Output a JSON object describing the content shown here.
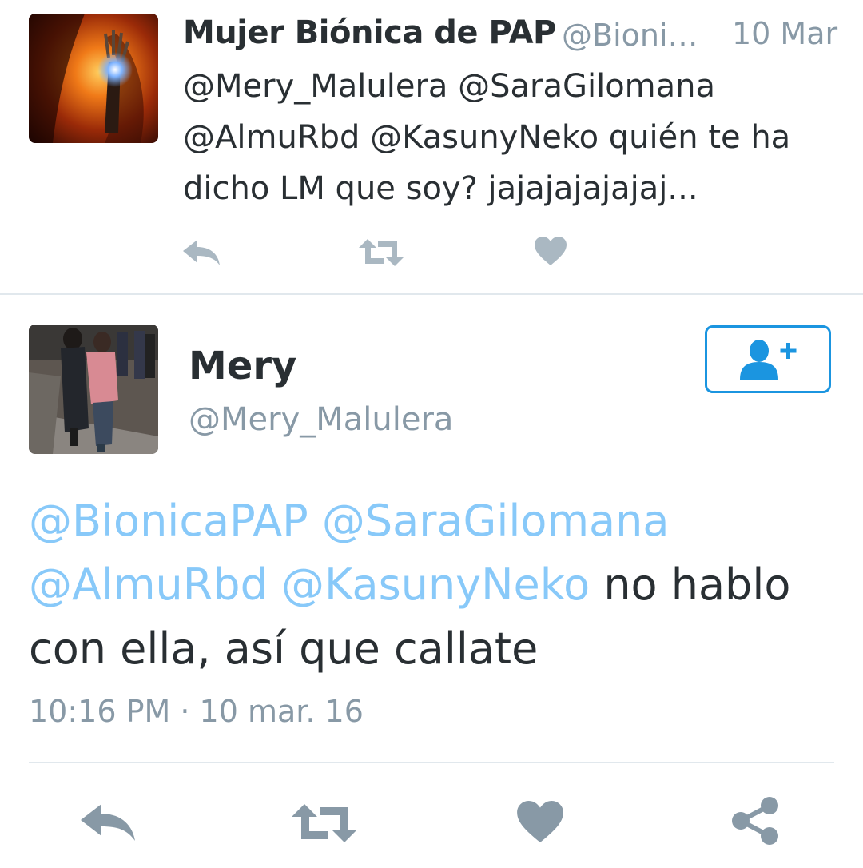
{
  "reply_tweet": {
    "author_name": "Mujer Biónica de PAP",
    "author_handle": "@BionicaPAP",
    "date": "10 Mar",
    "text_lines": [
      "@Mery_Malulera @SaraGilomana",
      "@AlmuRbd @KasunyNeko quién te ha",
      "dicho LM que soy? jajajajajajaj..."
    ],
    "actions": [
      "reply-icon",
      "retweet-icon",
      "like-icon"
    ],
    "icon_color": "#aab8c2"
  },
  "main_tweet": {
    "author_name": "Mery",
    "author_handle": "@Mery_Malulera",
    "follow_icon": "add-user-icon",
    "mentions": [
      "@BionicaPAP",
      "@SaraGilomana",
      "@AlmuRbd",
      "@KasunyNeko"
    ],
    "text_after_mentions_line2": "no hablo",
    "text_line3": "con ella, así que callate",
    "timestamp": "10:16 PM · 10 mar. 16",
    "actions": [
      "reply-icon",
      "retweet-icon",
      "like-icon",
      "share-icon"
    ]
  },
  "colors": {
    "mention": "#88c9f9",
    "accent": "#1b95e0",
    "secondary_text": "#8899a6",
    "primary_text": "#292f33",
    "divider": "#e1e8ed"
  }
}
